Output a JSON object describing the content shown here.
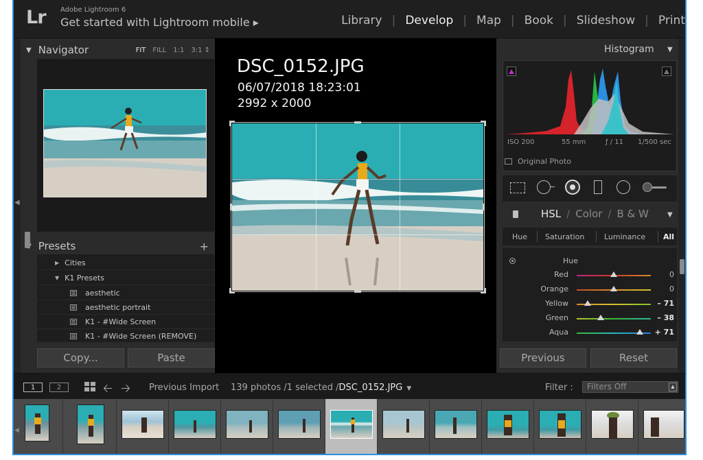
{
  "app": {
    "logo": "Lr",
    "name": "Adobe Lightroom 6",
    "mobile_link": "Get started with Lightroom mobile  ▸"
  },
  "modules": [
    {
      "label": "Library",
      "active": false
    },
    {
      "label": "Develop",
      "active": true
    },
    {
      "label": "Map",
      "active": false
    },
    {
      "label": "Book",
      "active": false
    },
    {
      "label": "Slideshow",
      "active": false
    },
    {
      "label": "Print",
      "active": false
    }
  ],
  "navigator": {
    "title": "Navigator",
    "zoom": [
      "FIT",
      "FILL",
      "1:1",
      "3:1 ↕"
    ]
  },
  "presets": {
    "title": "Presets",
    "add": "+",
    "items": [
      {
        "label": "Cities",
        "type": "folder-collapsed"
      },
      {
        "label": "K1 Presets",
        "type": "folder-expanded"
      },
      {
        "label": "aesthetic",
        "type": "preset"
      },
      {
        "label": "aesthetic portrait",
        "type": "preset"
      },
      {
        "label": "K1 - #Wide Screen",
        "type": "preset"
      },
      {
        "label": "K1 - #Wide Screen (REMOVE)",
        "type": "preset"
      }
    ]
  },
  "left_buttons": {
    "copy": "Copy...",
    "paste": "Paste"
  },
  "photo_info": {
    "filename": "DSC_0152.JPG",
    "datetime": "06/07/2018 18:23:01",
    "dimensions": "2992 x 2000"
  },
  "histogram": {
    "title": "Histogram",
    "iso": "ISO 200",
    "focal": "55 mm",
    "aperture": "ƒ / 11",
    "shutter": "1/500 sec",
    "original_photo": "Original Photo"
  },
  "hsl": {
    "tabs": [
      "HSL",
      "/",
      "Color",
      "/",
      "B & W"
    ],
    "subtabs": [
      "Hue",
      "Saturation",
      "Luminance",
      "All"
    ],
    "section": "Hue",
    "sliders": [
      {
        "name": "Red",
        "value": "0",
        "position": 0.5
      },
      {
        "name": "Orange",
        "value": "0",
        "position": 0.5
      },
      {
        "name": "Yellow",
        "value": "– 71",
        "position": 0.15
      },
      {
        "name": "Green",
        "value": "– 38",
        "position": 0.32
      },
      {
        "name": "Aqua",
        "value": "+ 71",
        "position": 0.85
      }
    ]
  },
  "right_buttons": {
    "previous": "Previous",
    "reset": "Reset"
  },
  "filmstrip_bar": {
    "screen1": "1",
    "screen2": "2",
    "source": "Previous Import",
    "count": "139 photos /1 selected /",
    "current_file": "DSC_0152.JPG",
    "filter_label": "Filter :",
    "filter_value": "Filters Off"
  },
  "colors": {
    "accent_border": "#2a8de0",
    "sea": "#2fb3b7",
    "sand": "#d8cfc4"
  }
}
